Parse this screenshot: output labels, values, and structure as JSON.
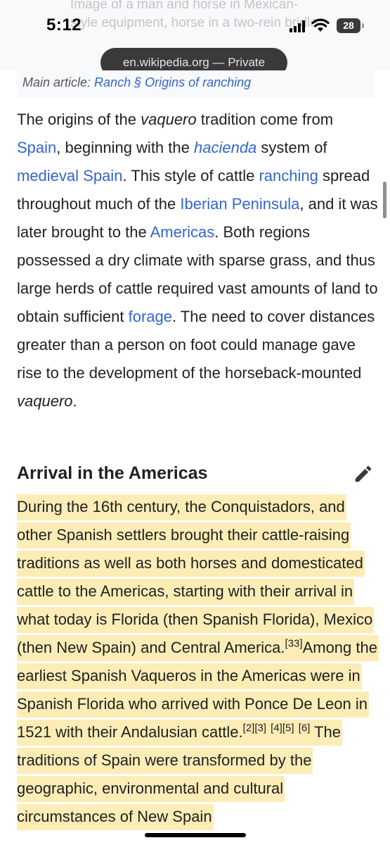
{
  "image_caption": {
    "text": "Image of a man and horse in Mexican-style equipment, horse in a two-rein bridle"
  },
  "status_bar": {
    "time": "5:12",
    "battery_level": "28"
  },
  "browser": {
    "url_label": "en.wikipedia.org — Private"
  },
  "hatnote": {
    "prefix": "Main article: ",
    "link_text": "Ranch § Origins of ranching"
  },
  "origins_paragraph": {
    "t1": "The origins of the ",
    "t2": "vaquero",
    "t3": " tradition come from ",
    "l1": "Spain",
    "t4": ", beginning with the ",
    "l2": "hacienda",
    "t5": " system of ",
    "l3": "medieval Spain",
    "t6": ". This style of cattle ",
    "l4": "ranching",
    "t7": " spread throughout much of the ",
    "l5": "Iberian Peninsula",
    "t8": ", and it was later brought to the ",
    "l6": "Americas",
    "t9": ". Both regions possessed a dry climate with sparse grass, and thus large herds of cattle required vast amounts of land to obtain sufficient ",
    "l7": "forage",
    "t10": ". The need to cover distances greater than a person on foot could manage gave rise to the development of the horseback-mounted ",
    "t11": "vaquero",
    "t12": "."
  },
  "section": {
    "heading": "Arrival in the Americas"
  },
  "arrival_paragraph": {
    "t1": "During the 16th century, the Conquistadors, and other Spanish settlers brought their cattle-raising traditions as well as both horses and domesticated cattle to the Americas, starting with their arrival in what today is Florida (then Spanish Florida), Mexico (then New Spain) and Central America.",
    "ref1": "[33]",
    "t2": "Among the earliest Spanish Vaqueros in the Americas were in Spanish Florida who arrived with Ponce De Leon in 1521 with their Andalusian cattle.",
    "ref2": "[2]",
    "ref3": "[3]",
    "ref4": "[4]",
    "ref5": "[5]",
    "ref6": "[6]",
    "t3": " The traditions of Spain were transformed by the geographic, environmental and cultural circumstances of New Spain"
  },
  "colors": {
    "link": "#3366cc",
    "highlight": "#fcedb6",
    "text": "#202122"
  },
  "icons": [
    "signal-icon",
    "wifi-icon",
    "battery-icon",
    "edit-pencil-icon"
  ]
}
